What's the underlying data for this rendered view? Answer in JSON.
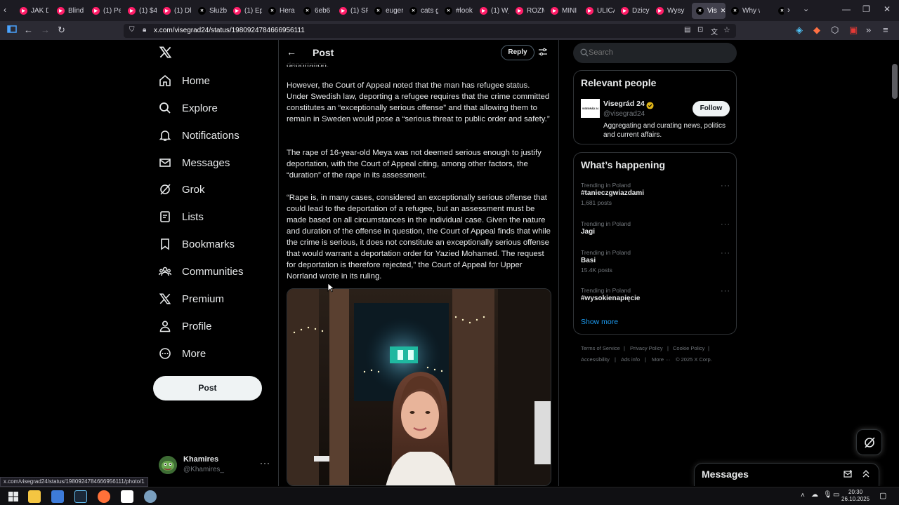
{
  "browser": {
    "tabs": [
      {
        "label": "JAK D",
        "icon_color": "#ff1d68"
      },
      {
        "label": "Blind",
        "icon_color": "#ff1d68"
      },
      {
        "label": "(1) Pe",
        "icon_color": "#ff1d68"
      },
      {
        "label": "(1) $4",
        "icon_color": "#ff1d68"
      },
      {
        "label": "(1) Dl",
        "icon_color": "#ff1d68"
      },
      {
        "label": "Służb",
        "icon_color": "#000000"
      },
      {
        "label": "(1) Ep",
        "icon_color": "#ff1d68"
      },
      {
        "label": "Hera",
        "icon_color": "#000000"
      },
      {
        "label": "6eb6",
        "icon_color": "#000000"
      },
      {
        "label": "(1) SP",
        "icon_color": "#ff1d68"
      },
      {
        "label": "euger",
        "icon_color": "#000000"
      },
      {
        "label": "cats g",
        "icon_color": "#000000"
      },
      {
        "label": "#look",
        "icon_color": "#000000"
      },
      {
        "label": "(1) Wj",
        "icon_color": "#ff1d68"
      },
      {
        "label": "ROZM",
        "icon_color": "#ff1d68"
      },
      {
        "label": "MINI",
        "icon_color": "#ff1d68"
      },
      {
        "label": "ULICA",
        "icon_color": "#ff1d68"
      },
      {
        "label": "Dzicy",
        "icon_color": "#ff1d68"
      },
      {
        "label": "Wysy",
        "icon_color": "#ff1d68"
      },
      {
        "label": "Vis",
        "icon_color": "#000000"
      },
      {
        "label": "Why w",
        "icon_color": "#000000"
      },
      {
        "label": "",
        "icon_color": "#000000"
      }
    ],
    "url": "x.com/visegrad24/status/1980924784666956111",
    "status_url": "x.com/visegrad24/status/1980924784666956111/photo/1"
  },
  "nav": {
    "items": [
      {
        "label": "Home",
        "icon": "home-icon"
      },
      {
        "label": "Explore",
        "icon": "search-icon"
      },
      {
        "label": "Notifications",
        "icon": "bell-icon"
      },
      {
        "label": "Messages",
        "icon": "mail-icon"
      },
      {
        "label": "Grok",
        "icon": "grok-icon"
      },
      {
        "label": "Lists",
        "icon": "list-icon"
      },
      {
        "label": "Bookmarks",
        "icon": "bookmark-icon"
      },
      {
        "label": "Communities",
        "icon": "communities-icon"
      },
      {
        "label": "Premium",
        "icon": "x-logo-icon"
      },
      {
        "label": "Profile",
        "icon": "person-icon"
      },
      {
        "label": "More",
        "icon": "more-circle-icon"
      }
    ],
    "post_button": "Post",
    "user": {
      "name": "Khamires",
      "handle": "@Khamires_"
    }
  },
  "post": {
    "header_title": "Post",
    "reply_button": "Reply",
    "cut_line": "deportation.",
    "paragraphs": [
      "However, the Court of Appeal noted that the man has refugee status. Under Swedish law, deporting a refugee requires that the crime committed constitutes an “exceptionally serious offense” and that allowing them to remain in Sweden would pose a “serious threat to public order and safety.”",
      "The rape of 16-year-old Meya was not deemed serious enough to justify deportation, with the Court of Appeal citing, among other factors, the “duration” of the rape in its assessment.",
      "“Rape is, in many cases, considered an exceptionally serious offense that could lead to the deportation of a refugee, but an assessment must be made based on all circumstances in the individual case. Given the nature and duration of the offense in question, the Court of Appeal finds that while the crime is serious, it does not constitute an exceptionally serious offense that would warrant a deportation order for Yazied Mohamed. The request for deportation is therefore rejected,” the Court of Appeal for Upper Norrland wrote in its ruling."
    ]
  },
  "search": {
    "placeholder": "Search"
  },
  "relevant": {
    "title": "Relevant people",
    "name": "Visegrád 24",
    "handle": "@visegrad24",
    "bio": "Aggregating and curating news, politics and current affairs.",
    "follow": "Follow",
    "avatar_text": "VISEGRÁD 24"
  },
  "happening": {
    "title": "What’s happening",
    "trends": [
      {
        "meta": "Trending in Poland",
        "name": "#tanieczgwiazdami",
        "count": "1,681 posts"
      },
      {
        "meta": "Trending in Poland",
        "name": "Jagi",
        "count": ""
      },
      {
        "meta": "Trending in Poland",
        "name": "Basi",
        "count": "15.4K posts"
      },
      {
        "meta": "Trending in Poland",
        "name": "#wysokienapięcie",
        "count": ""
      }
    ],
    "show_more": "Show more"
  },
  "footer": {
    "terms": "Terms of Service",
    "privacy": "Privacy Policy",
    "cookie": "Cookie Policy",
    "accessibility": "Accessibility",
    "ads": "Ads info",
    "more": "More ···",
    "copyright": "© 2025 X Corp."
  },
  "messages_drawer": {
    "title": "Messages"
  },
  "taskbar": {
    "time": "20:30",
    "date": "26.10.2025"
  },
  "colors": {
    "accent": "#1d9bf0",
    "bg": "#000000",
    "border": "#2f3336",
    "muted": "#71767b",
    "verified": "#e2b719"
  }
}
